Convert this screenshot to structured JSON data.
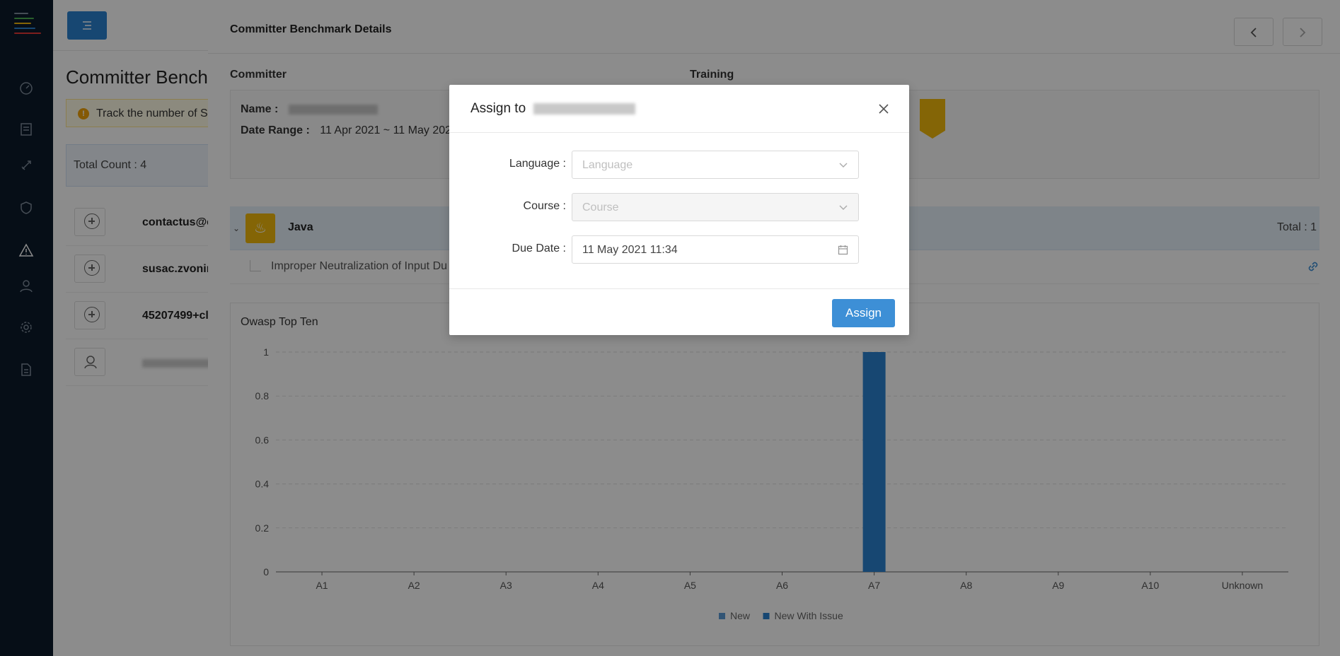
{
  "sidebar": {
    "icons": [
      "dashboard-icon",
      "list-icon",
      "rocket-icon",
      "shield-icon",
      "warning-icon",
      "user-icon",
      "gear-icon",
      "document-icon"
    ]
  },
  "page": {
    "title": "Committer Benchmark",
    "alert_text": "Track the number of S",
    "total_count": "Total Count : 4",
    "rows": [
      {
        "name": "contactus@c"
      },
      {
        "name": "susac.zvonir"
      },
      {
        "name": "45207499+cl"
      },
      {
        "name": ""
      }
    ]
  },
  "drawer": {
    "title": "Committer Benchmark Details",
    "committer_label": "Committer",
    "training_label": "Training",
    "name_label": "Name :",
    "date_range_label": "Date Range :",
    "date_range_value": "11 Apr 2021 ~ 11 May 202",
    "language": "Java",
    "language_total": "Total : 1",
    "issue_text": "Improper Neutralization of Input Du"
  },
  "chart_data": {
    "type": "bar",
    "title": "Owasp Top Ten",
    "categories": [
      "A1",
      "A2",
      "A3",
      "A4",
      "A5",
      "A6",
      "A7",
      "A8",
      "A9",
      "A10",
      "Unknown"
    ],
    "series": [
      {
        "name": "New",
        "values": [
          0,
          0,
          0,
          0,
          0,
          0,
          0,
          0,
          0,
          0,
          0
        ],
        "color": "#5b9bd5"
      },
      {
        "name": "New With Issue",
        "values": [
          0,
          0,
          0,
          0,
          0,
          0,
          1,
          0,
          0,
          0,
          0
        ],
        "color": "#2b82cf"
      }
    ],
    "y_ticks": [
      "0",
      "0.2",
      "0.4",
      "0.6",
      "0.8",
      "1"
    ],
    "ylim": [
      0,
      1
    ],
    "grid": true,
    "legend": "bottom"
  },
  "modal": {
    "title": "Assign to",
    "language_label": "Language",
    "language_placeholder": "Language",
    "course_label": "Course",
    "course_placeholder": "Course",
    "due_date_label": "Due Date",
    "due_date_value": "11 May 2021 11:34",
    "assign_label": "Assign"
  },
  "colors": {
    "sidebar": "#0c1a2b",
    "primary": "#3d8fd6",
    "badge": "#f0b90b"
  }
}
